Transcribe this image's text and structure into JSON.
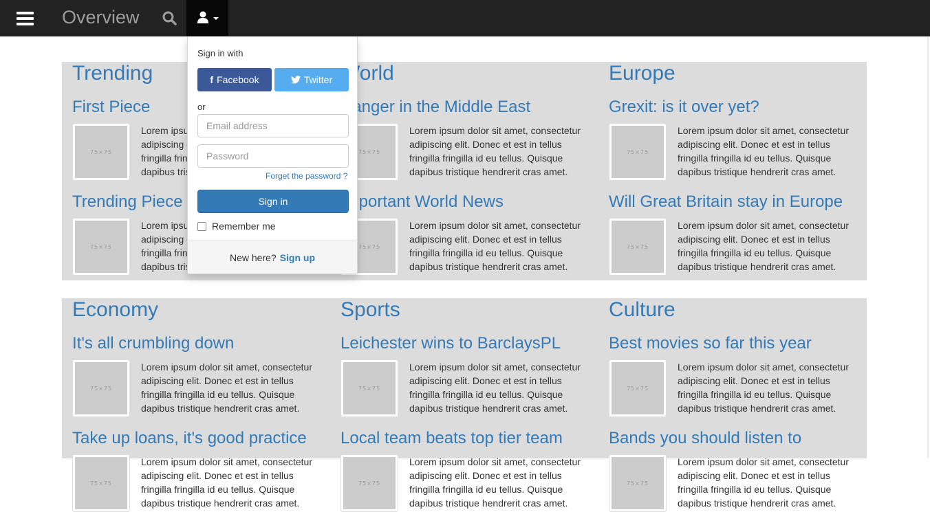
{
  "nav": {
    "title": "Overview"
  },
  "signin": {
    "heading": "Sign in with",
    "facebook": "Facebook",
    "twitter": "Twitter",
    "or": "or",
    "email_placeholder": "Email address",
    "password_placeholder": "Password",
    "forgot": "Forget the password ?",
    "submit": "Sign in",
    "remember": "Remember me",
    "new_here": "New here?",
    "signup": "Sign up"
  },
  "thumb_label": "75×75",
  "lorem": "Lorem ipsum dolor sit amet, consectetur adipiscing elit. Donec et est in tellus fringilla fringilla id eu tellus. Quisque dapibus tristique hendrerit cras amet.",
  "sections": [
    {
      "columns": [
        {
          "category": "Trending",
          "articles": [
            "First Piece",
            "Trending Piece"
          ]
        },
        {
          "category": "World",
          "articles": [
            "Danger in the Middle East",
            "Important World News"
          ]
        },
        {
          "category": "Europe",
          "articles": [
            "Grexit: is it over yet?",
            "Will Great Britain stay in Europe"
          ]
        }
      ]
    },
    {
      "columns": [
        {
          "category": "Economy",
          "articles": [
            "It's all crumbling down",
            "Take up loans, it's good practice"
          ]
        },
        {
          "category": "Sports",
          "articles": [
            "Leichester wins to BarclaysPL",
            "Local team beats top tier team"
          ]
        },
        {
          "category": "Culture",
          "articles": [
            "Best movies so far this year",
            "Bands you should listen to"
          ]
        }
      ]
    }
  ]
}
